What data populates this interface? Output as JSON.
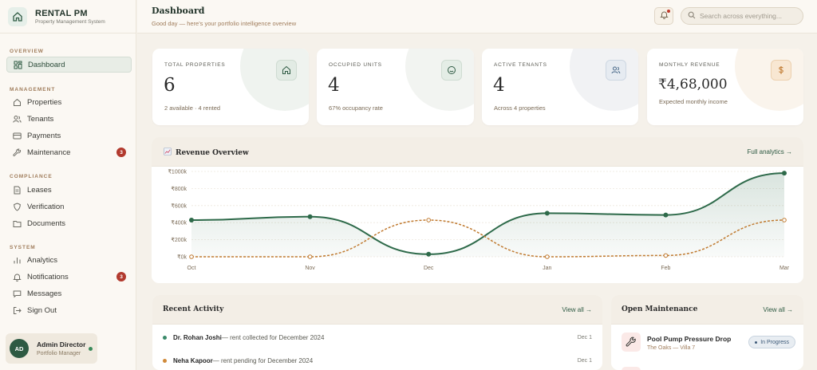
{
  "brand": {
    "name": "RENTAL PM",
    "subtitle": "Property Management System"
  },
  "sidebar": {
    "sections": {
      "overview": "OVERVIEW",
      "management": "MANAGEMENT",
      "compliance": "COMPLIANCE",
      "system": "SYSTEM"
    },
    "items": [
      {
        "label": "Dashboard",
        "icon": "dashboard-icon",
        "active": true
      },
      {
        "label": "Properties",
        "icon": "home-icon"
      },
      {
        "label": "Tenants",
        "icon": "users-icon"
      },
      {
        "label": "Payments",
        "icon": "card-icon"
      },
      {
        "label": "Maintenance",
        "icon": "wrench-icon",
        "badge": "3"
      },
      {
        "label": "Leases",
        "icon": "document-icon"
      },
      {
        "label": "Verification",
        "icon": "shield-icon"
      },
      {
        "label": "Documents",
        "icon": "folder-icon"
      },
      {
        "label": "Analytics",
        "icon": "bar-chart-icon"
      },
      {
        "label": "Notifications",
        "icon": "bell-icon",
        "badge": "3"
      },
      {
        "label": "Messages",
        "icon": "message-icon"
      },
      {
        "label": "Sign Out",
        "icon": "logout-icon"
      }
    ],
    "user": {
      "initials": "AD",
      "name": "Admin Director",
      "role": "Portfolio Manager"
    }
  },
  "header": {
    "title": "Dashboard",
    "subtitle": "Good day — here's your portfolio intelligence overview",
    "search_placeholder": "Search across everything..."
  },
  "stats": [
    {
      "label": "TOTAL PROPERTIES",
      "value": "6",
      "hint": "2 available · 4 rented",
      "icon": "home-icon",
      "color": "#2e5a43"
    },
    {
      "label": "OCCUPIED UNITS",
      "value": "4",
      "hint": "67% occupancy rate",
      "icon": "smile-icon",
      "color": "#2e5a43"
    },
    {
      "label": "ACTIVE TENANTS",
      "value": "4",
      "hint": "Across 4 properties",
      "icon": "users-icon",
      "color": "#4a6a8a"
    },
    {
      "label": "MONTHLY REVENUE",
      "value": "₹4,68,000",
      "hint": "Expected monthly income",
      "icon": "rupee-icon",
      "color": "#c07a30"
    }
  ],
  "revenue": {
    "title": "Revenue Overview",
    "link": "Full analytics →"
  },
  "chart_data": {
    "type": "line",
    "title": "Revenue Overview",
    "categories": [
      "Oct",
      "Nov",
      "Dec",
      "Jan",
      "Feb",
      "Mar"
    ],
    "y_ticks": [
      "₹1000k",
      "₹800k",
      "₹600k",
      "₹400k",
      "₹200k",
      "₹0k"
    ],
    "ylim": [
      0,
      1000
    ],
    "series": [
      {
        "values": [
          430,
          470,
          30,
          510,
          490,
          980
        ],
        "color": "#2e6a4a",
        "style": "solid",
        "area": true
      },
      {
        "values": [
          0,
          0,
          430,
          0,
          15,
          430
        ],
        "color": "#c07a30",
        "style": "dashed",
        "area": false
      }
    ],
    "grid": true,
    "legend": "none"
  },
  "activity": {
    "title": "Recent Activity",
    "link": "View all →",
    "items": [
      {
        "name": "Dr. Rohan Joshi",
        "text": " — rent collected for December 2024",
        "date": "Dec 1",
        "color": "#3a8a6a"
      },
      {
        "name": "Neha Kapoor",
        "text": " — rent pending for December 2024",
        "date": "Dec 1",
        "color": "#d08a3a"
      }
    ]
  },
  "maintenance": {
    "title": "Open Maintenance",
    "link": "View all →",
    "items": [
      {
        "title": "Pool Pump Pressure Drop",
        "location": "The Oaks — Villa 7",
        "status": "In Progress"
      }
    ]
  }
}
